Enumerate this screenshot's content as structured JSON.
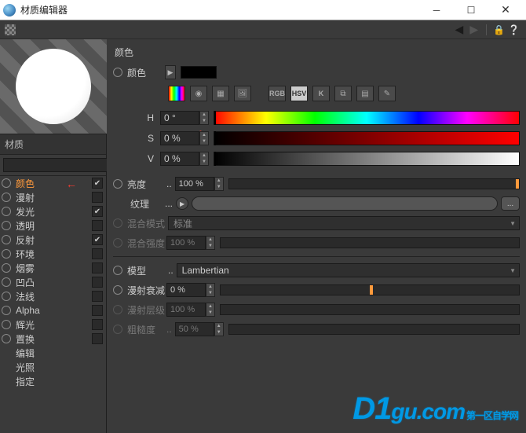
{
  "window": {
    "title": "材质编辑器"
  },
  "left": {
    "material_name": "材质",
    "search_placeholder": "",
    "channels": [
      {
        "label": "颜色",
        "checked": true,
        "ring": true,
        "selected": true
      },
      {
        "label": "漫射",
        "checked": false,
        "ring": true,
        "selected": false
      },
      {
        "label": "发光",
        "checked": true,
        "ring": true,
        "selected": false
      },
      {
        "label": "透明",
        "checked": false,
        "ring": true,
        "selected": false
      },
      {
        "label": "反射",
        "checked": true,
        "ring": true,
        "selected": false
      },
      {
        "label": "环境",
        "checked": false,
        "ring": true,
        "selected": false
      },
      {
        "label": "烟雾",
        "checked": false,
        "ring": true,
        "selected": false
      },
      {
        "label": "凹凸",
        "checked": false,
        "ring": true,
        "selected": false
      },
      {
        "label": "法线",
        "checked": false,
        "ring": true,
        "selected": false
      },
      {
        "label": "Alpha",
        "checked": false,
        "ring": true,
        "selected": false
      },
      {
        "label": "辉光",
        "checked": false,
        "ring": true,
        "selected": false
      },
      {
        "label": "置换",
        "checked": false,
        "ring": true,
        "selected": false
      },
      {
        "label": "编辑",
        "checked": false,
        "ring": false,
        "selected": false,
        "nochk": true
      },
      {
        "label": "光照",
        "checked": false,
        "ring": false,
        "selected": false,
        "nochk": true
      },
      {
        "label": "指定",
        "checked": false,
        "ring": false,
        "selected": false,
        "nochk": true
      }
    ]
  },
  "right": {
    "section": "颜色",
    "color_label": "颜色",
    "picker_btns": {
      "rgb": "RGB",
      "hsv": "HSV",
      "k": "K"
    },
    "hsv": {
      "h_label": "H",
      "h_value": "0 °",
      "s_label": "S",
      "s_value": "0 %",
      "v_label": "V",
      "v_value": "0 %"
    },
    "brightness": {
      "label": "亮度",
      "value": "100 %",
      "knob": 100
    },
    "texture": {
      "label": "纹理",
      "browse": "..."
    },
    "blend_mode": {
      "label": "混合模式",
      "value": "标准"
    },
    "blend_strength": {
      "label": "混合强度",
      "value": "100 %"
    },
    "model": {
      "label": "模型",
      "value": "Lambertian"
    },
    "falloff": {
      "label": "漫射衰减",
      "value": "0 %",
      "knob": 68
    },
    "layers": {
      "label": "漫射层级",
      "value": "100 %"
    },
    "roughness": {
      "label": "粗糙度",
      "value": "50 %"
    }
  },
  "watermark": {
    "d1": "D1",
    "gu": "gu",
    "com": ".com",
    "sub": "第一区自学网"
  }
}
